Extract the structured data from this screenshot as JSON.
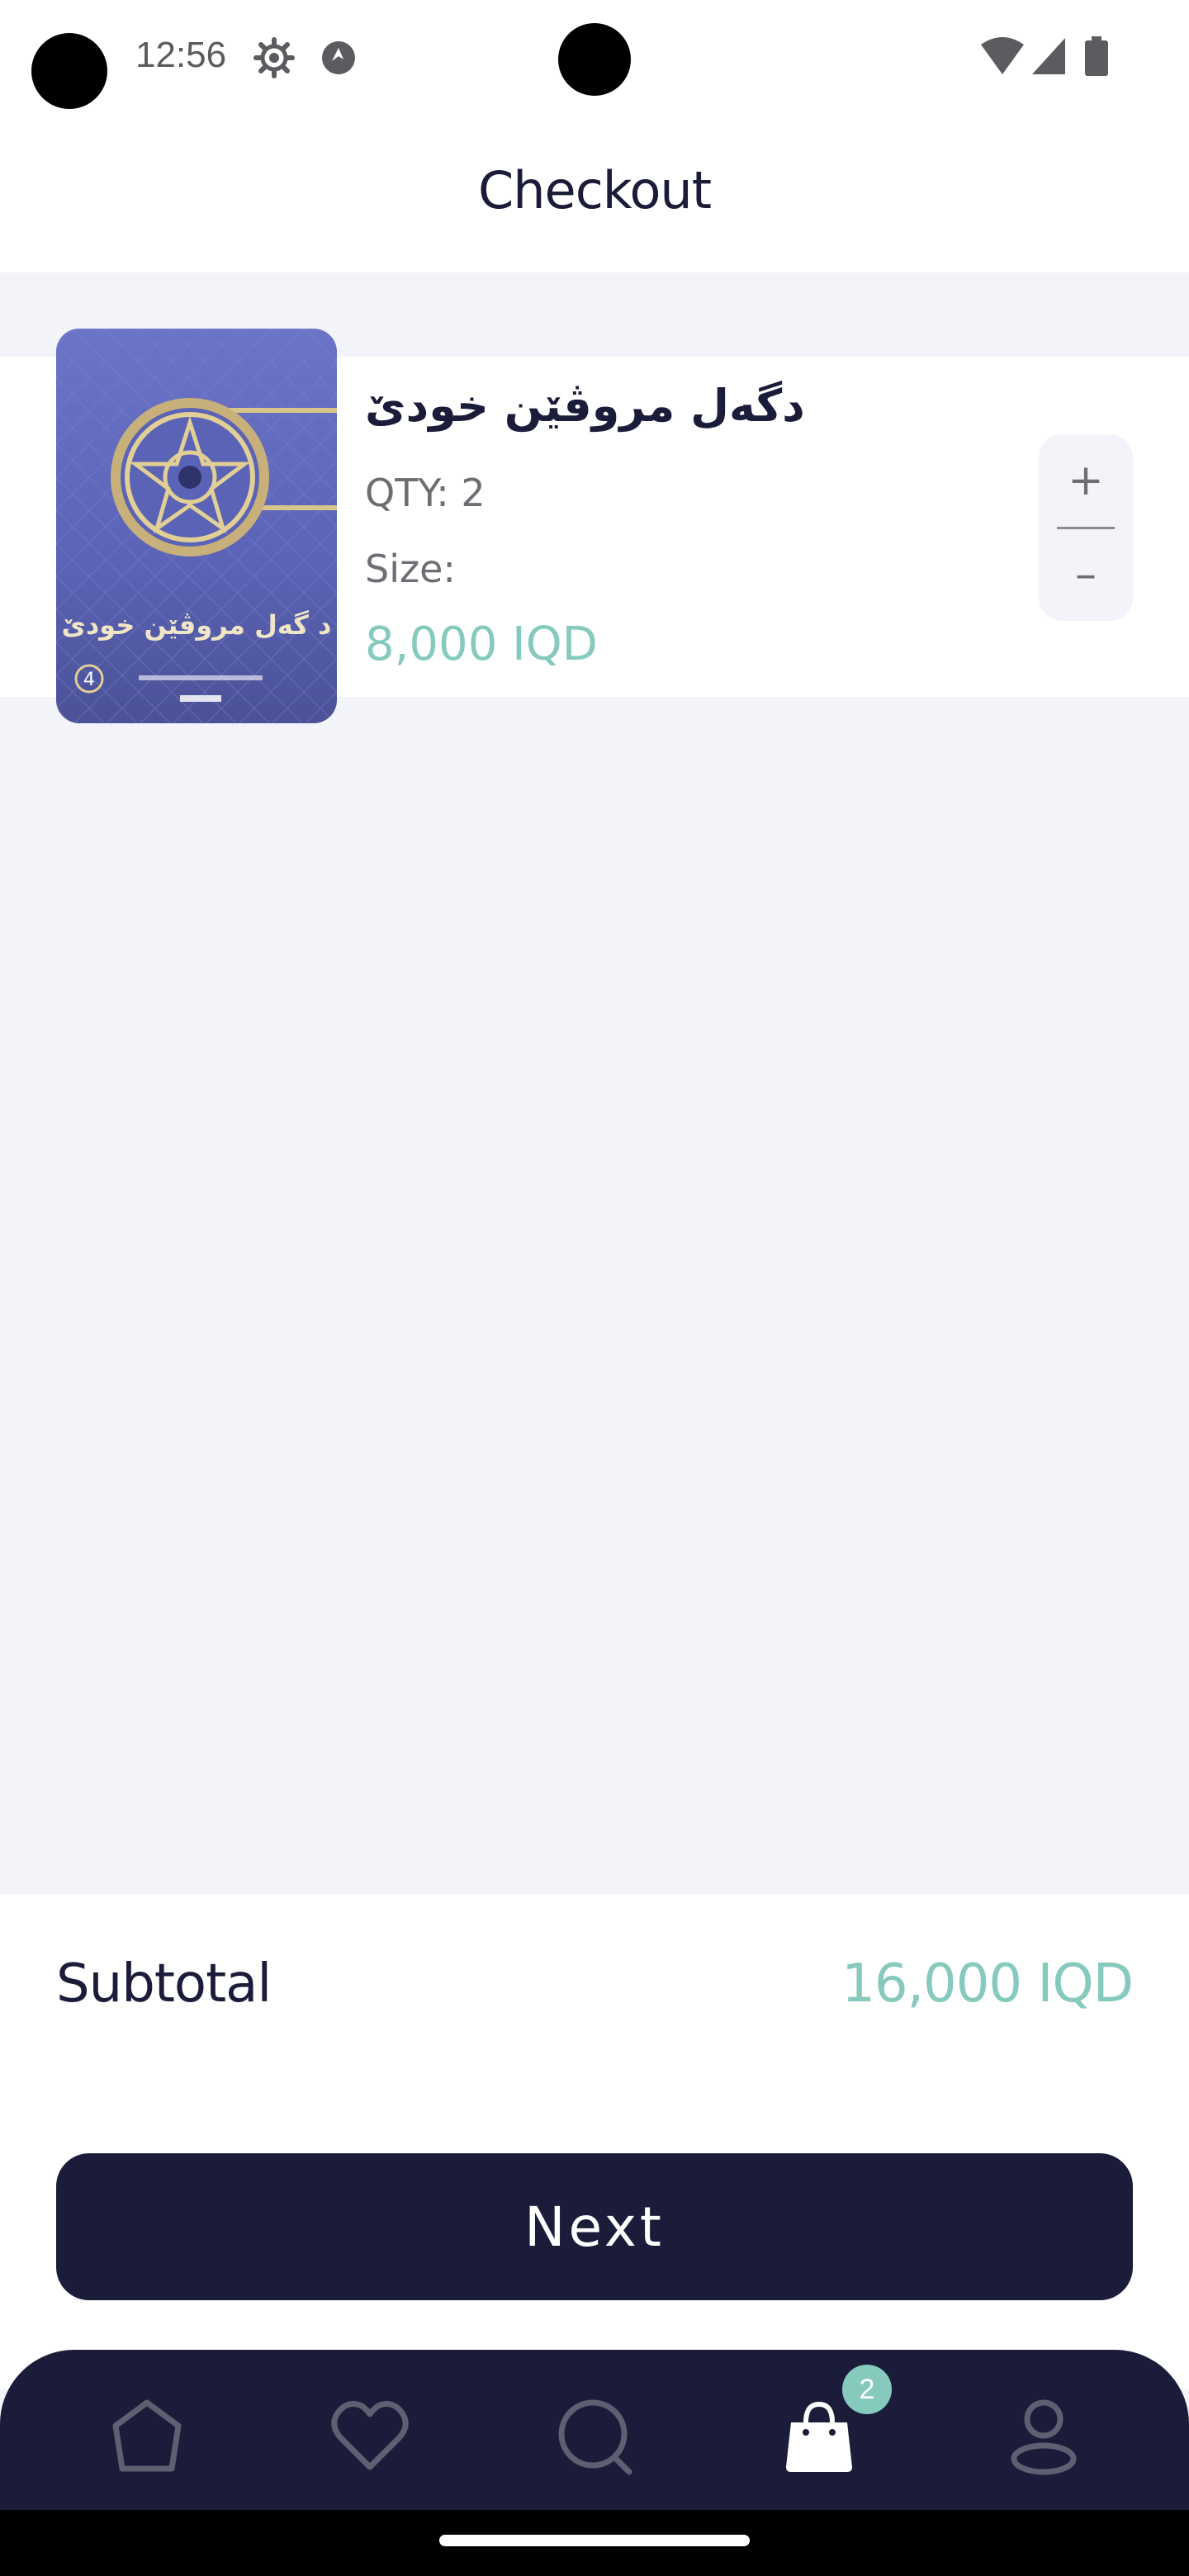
{
  "status_bar": {
    "time": "12:56",
    "icons": [
      "settings-icon",
      "notification-icon",
      "wifi-icon",
      "signal-icon",
      "battery-icon"
    ]
  },
  "header": {
    "title": "Checkout"
  },
  "cart": {
    "items": [
      {
        "name": "دگەل مروڤێن خودێ",
        "qty_text": "QTY: 2",
        "size_text": "Size:",
        "price": "8,000 IQD",
        "cover_title": "د گەل مروڤێن خودێ",
        "cover_badge": "4",
        "increment_label": "+",
        "decrement_label": "–"
      }
    ]
  },
  "summary": {
    "subtotal_label": "Subtotal",
    "subtotal_value": "16,000 IQD",
    "next_label": "Next"
  },
  "bottom_nav": {
    "items": [
      "home-icon",
      "heart-icon",
      "chat-icon",
      "cart-bag-icon",
      "profile-icon"
    ],
    "active": "cart-bag-icon",
    "cart_badge": "2"
  },
  "colors": {
    "primary": "#1b1c3a",
    "accent": "#86c9bd",
    "background": "#f3f4f9",
    "surface": "#ffffff"
  }
}
